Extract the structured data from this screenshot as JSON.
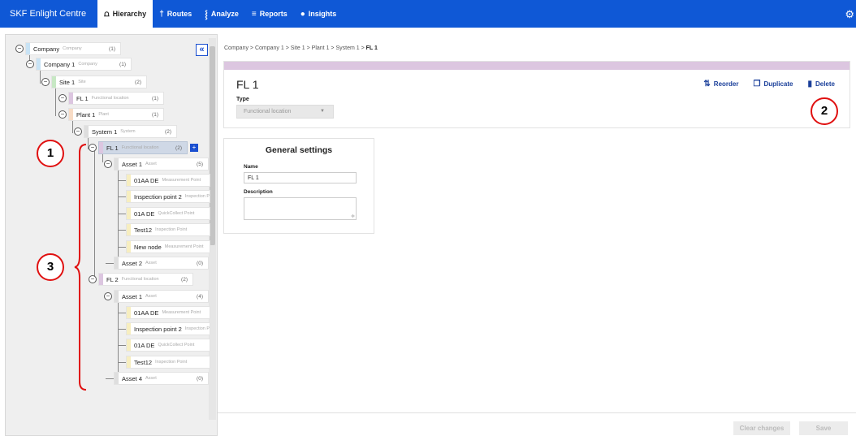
{
  "topbar": {
    "brand": "SKF Enlight Centre",
    "items": [
      {
        "label": "Hierarchy",
        "icon": "hierarchy-icon",
        "glyph": "⩍"
      },
      {
        "label": "Routes",
        "icon": "routes-icon",
        "glyph": "†"
      },
      {
        "label": "Analyze",
        "icon": "analyze-icon",
        "glyph": "⸾"
      },
      {
        "label": "Reports",
        "icon": "reports-icon",
        "glyph": "≡"
      },
      {
        "label": "Insights",
        "icon": "insights-icon",
        "glyph": "●"
      }
    ],
    "gear": "⚙"
  },
  "tree": {
    "collapse_glyph": "«",
    "nodes": [
      {
        "name": "Company",
        "type": "Company",
        "count": "(1)"
      },
      {
        "name": "Company 1",
        "type": "Company",
        "count": "(1)"
      },
      {
        "name": "Site 1",
        "type": "Site",
        "count": "(2)"
      },
      {
        "name": "FL 1",
        "type": "Functional location",
        "count": "(1)"
      },
      {
        "name": "Plant 1",
        "type": "Plant",
        "count": "(1)"
      },
      {
        "name": "System 1",
        "type": "System",
        "count": "(2)"
      },
      {
        "name": "FL 1",
        "type": "Functional location",
        "count": "(2)"
      },
      {
        "name": "Asset 1",
        "type": "Asset",
        "count": "(5)"
      },
      {
        "name": "01AA DE",
        "type": "Measurement Point",
        "count": ""
      },
      {
        "name": "Inspection point 2",
        "type": "Inspection Point",
        "count": ""
      },
      {
        "name": "01A DE",
        "type": "QuickCollect Point",
        "count": ""
      },
      {
        "name": "Test12",
        "type": "Inspection Point",
        "count": ""
      },
      {
        "name": "New node",
        "type": "Measurement Point",
        "count": ""
      },
      {
        "name": "Asset 2",
        "type": "Asset",
        "count": "(0)"
      },
      {
        "name": "FL 2",
        "type": "Functional location",
        "count": "(2)"
      },
      {
        "name": "Asset 1",
        "type": "Asset",
        "count": "(4)"
      },
      {
        "name": "01AA DE",
        "type": "Measurement Point",
        "count": ""
      },
      {
        "name": "Inspection point 2",
        "type": "Inspection Point",
        "count": ""
      },
      {
        "name": "01A DE",
        "type": "QuickCollect Point",
        "count": ""
      },
      {
        "name": "Test12",
        "type": "Inspection Point",
        "count": ""
      },
      {
        "name": "Asset 4",
        "type": "Asset",
        "count": "(0)"
      }
    ],
    "add_glyph": "+"
  },
  "breadcrumb": [
    "Company",
    "Company 1",
    "Site 1",
    "Plant 1",
    "System 1",
    "FL 1"
  ],
  "breadcrumb_sep": ">",
  "detail": {
    "title": "FL 1",
    "type_label": "Type",
    "type_value": "Functional location",
    "actions": [
      {
        "label": "Reorder",
        "icon": "reorder-icon",
        "glyph": "⇅"
      },
      {
        "label": "Duplicate",
        "icon": "duplicate-icon",
        "glyph": "❐"
      },
      {
        "label": "Delete",
        "icon": "delete-icon",
        "glyph": "▮"
      }
    ]
  },
  "settings": {
    "title": "General settings",
    "name_label": "Name",
    "name_value": "FL 1",
    "description_label": "Description",
    "description_value": ""
  },
  "footer": {
    "clear_label": "Clear changes",
    "save_label": "Save"
  },
  "callouts": [
    "1",
    "2",
    "3"
  ],
  "colors": {
    "nav": "#0f58d6",
    "company": "#c8e3f5",
    "site": "#c7e8c4",
    "functional_location": "#dcc6e0",
    "plant": "#f8dcc6",
    "system": "#dedede",
    "asset": "#dedede",
    "point": "#f7eec0",
    "callout": "#e01010"
  }
}
